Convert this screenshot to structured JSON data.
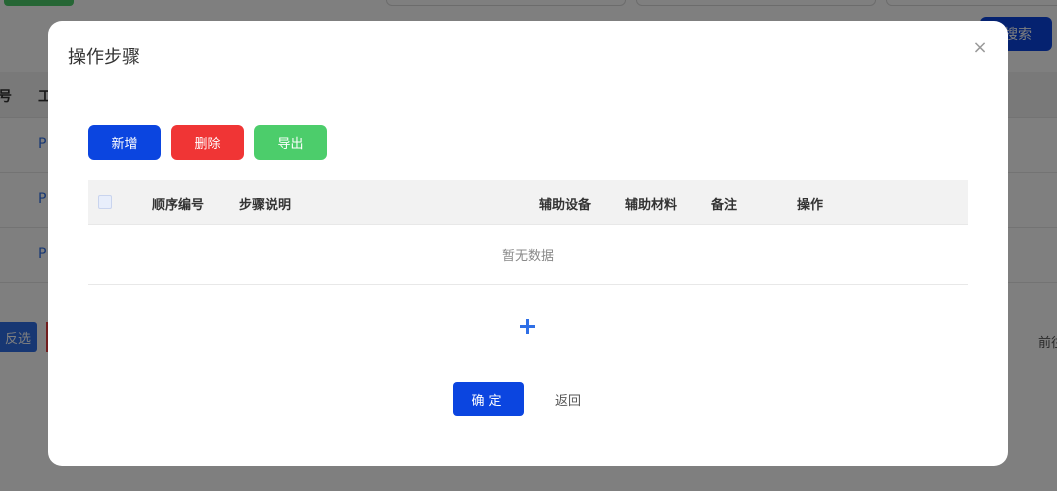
{
  "background": {
    "search_label": "搜索",
    "table_headers": [
      "号",
      "工"
    ],
    "row_prefix": "P",
    "invert_select_label": "反选",
    "goto_label": "前往"
  },
  "modal": {
    "title": "操作步骤",
    "close_icon": "×",
    "toolbar": {
      "add_label": "新增",
      "delete_label": "删除",
      "export_label": "导出"
    },
    "table": {
      "columns": [
        "顺序编号",
        "步骤说明",
        "辅助设备",
        "辅助材料",
        "备注",
        "操作"
      ],
      "empty_text": "暂无数据"
    },
    "add_row_icon": "plus-icon",
    "confirm_label": "确定",
    "back_label": "返回"
  },
  "colors": {
    "primary": "#0b45e0",
    "danger": "#f03535",
    "success": "#4ccd6b",
    "link": "#2f6fe6"
  }
}
